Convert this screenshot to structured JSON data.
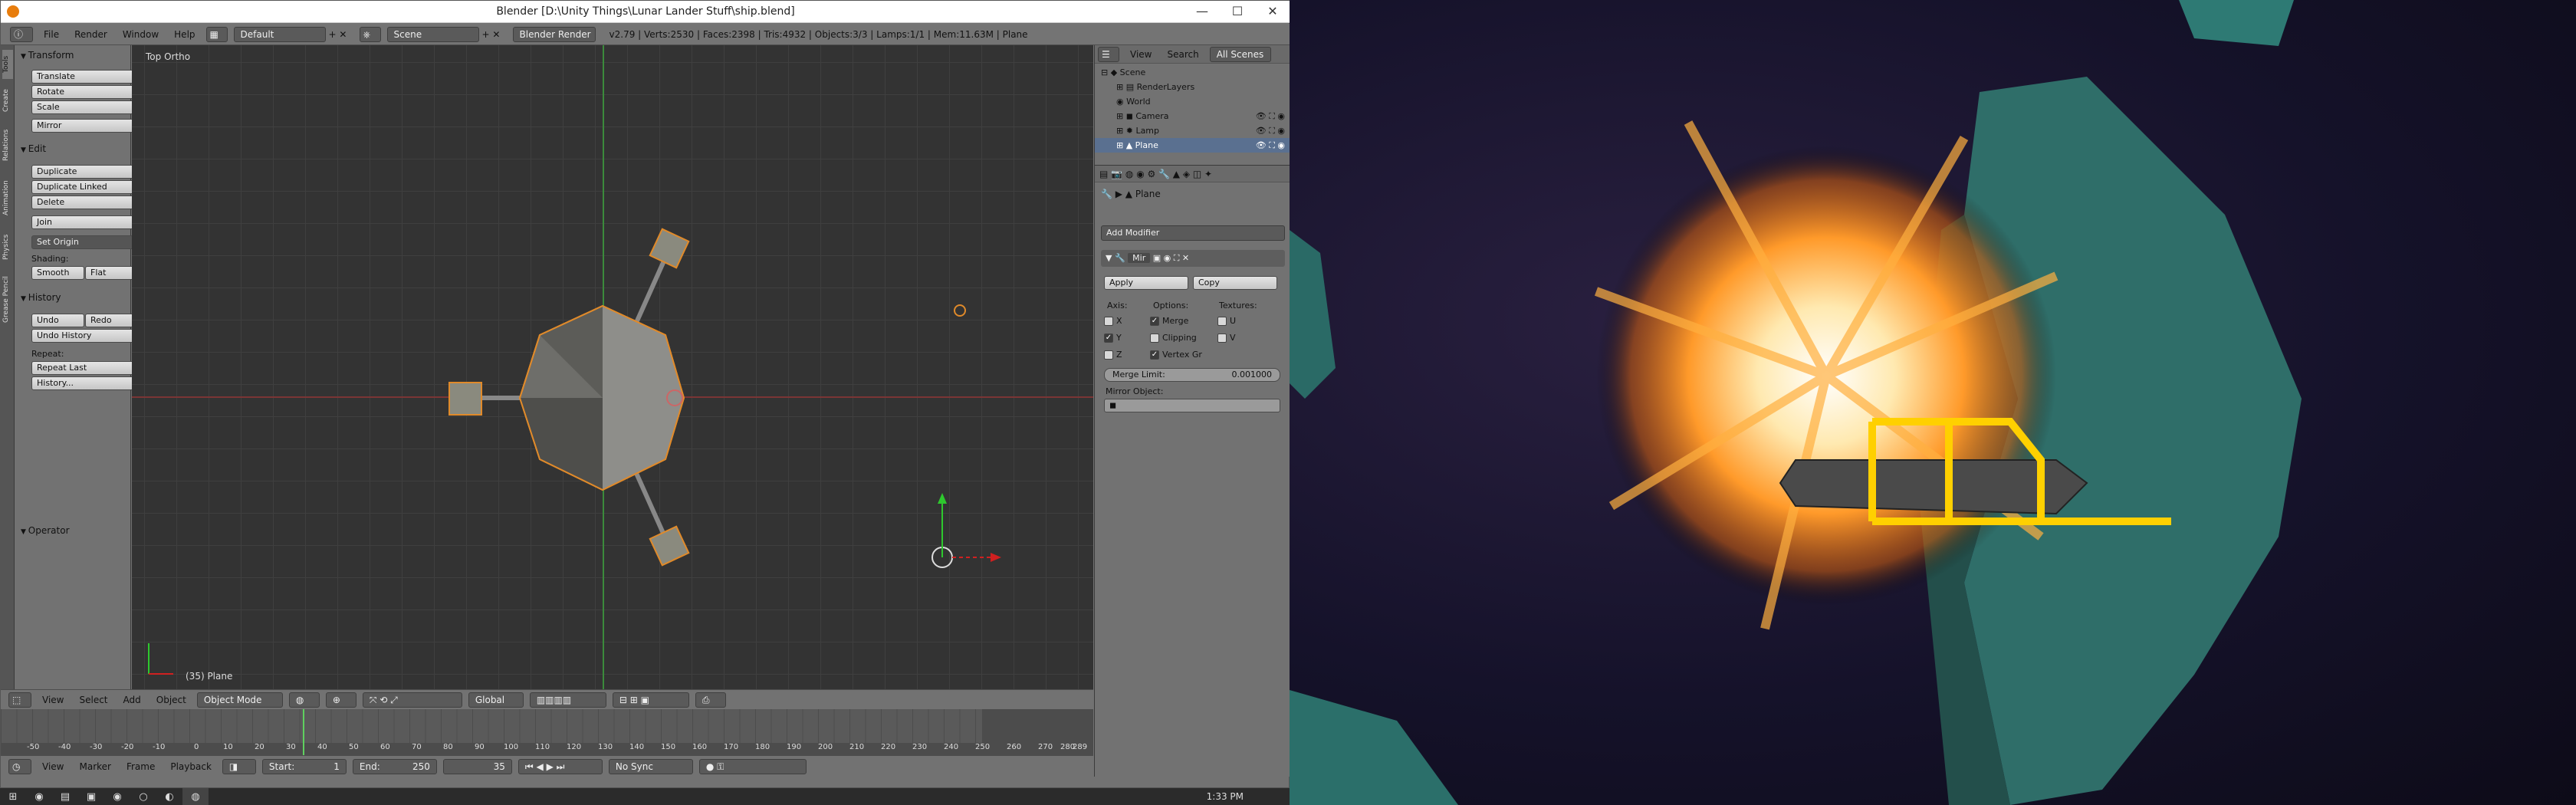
{
  "window": {
    "title": "Blender [D:\\Unity Things\\Lunar Lander Stuff\\ship.blend]",
    "minimize": "—",
    "maximize": "☐",
    "close": "✕"
  },
  "info_header": {
    "menu": [
      "File",
      "Render",
      "Window",
      "Help"
    ],
    "layout": "Default",
    "scene": "Scene",
    "engine": "Blender Render",
    "stats": "v2.79 | Verts:2530 | Faces:2398 | Tris:4932 | Objects:3/3 | Lamps:1/1 | Mem:11.63M | Plane"
  },
  "tool_shelf": {
    "tabs": [
      "Tools",
      "Create",
      "Relations",
      "Animation",
      "Physics",
      "Grease Pencil"
    ],
    "transform": {
      "heading": "Transform",
      "buttons": [
        "Translate",
        "Rotate",
        "Scale",
        "Mirror"
      ]
    },
    "edit": {
      "heading": "Edit",
      "buttons": [
        "Duplicate",
        "Duplicate Linked",
        "Delete",
        "Join"
      ],
      "set_origin": "Set Origin",
      "shading_label": "Shading:",
      "smooth": "Smooth",
      "flat": "Flat"
    },
    "history": {
      "heading": "History",
      "undo": "Undo",
      "redo": "Redo",
      "undo_history": "Undo History",
      "repeat_label": "Repeat:",
      "repeat_last": "Repeat Last",
      "history": "History..."
    },
    "operator_heading": "Operator"
  },
  "viewport": {
    "view_name": "Top Ortho",
    "object_label": "(35) Plane"
  },
  "view3d_header": {
    "menu": [
      "View",
      "Select",
      "Add",
      "Object"
    ],
    "mode": "Object Mode",
    "orientation": "Global"
  },
  "timeline": {
    "ticks": [
      "-50",
      "-40",
      "-30",
      "-20",
      "-10",
      "0",
      "10",
      "20",
      "30",
      "40",
      "50",
      "60",
      "70",
      "80",
      "90",
      "100",
      "110",
      "120",
      "130",
      "140",
      "150",
      "160",
      "170",
      "180",
      "190",
      "200",
      "210",
      "220",
      "230",
      "240",
      "250",
      "260",
      "270",
      "280",
      "289"
    ],
    "menu": [
      "View",
      "Marker",
      "Frame",
      "Playback"
    ],
    "start": "Start:",
    "start_val": "1",
    "end": "End:",
    "end_val": "250",
    "current": "35",
    "sync": "No Sync"
  },
  "outliner": {
    "menu": [
      "View",
      "Search"
    ],
    "scope": "All Scenes",
    "items": [
      "Scene",
      "RenderLayers",
      "World",
      "Camera",
      "Lamp",
      "Plane"
    ]
  },
  "properties": {
    "breadcrumb": "Plane",
    "add_modifier": "Add Modifier",
    "modifier_name": "Mir",
    "apply": "Apply",
    "copy": "Copy",
    "axis_label": "Axis:",
    "options_label": "Options:",
    "textures_label": "Textures:",
    "axes": [
      "X",
      "Y",
      "Z"
    ],
    "options": [
      "Merge",
      "Clipping",
      "Vertex Gr"
    ],
    "textures": [
      "U",
      "V"
    ],
    "merge_limit_label": "Merge Limit:",
    "merge_limit_value": "0.001000",
    "mirror_object_label": "Mirror Object:"
  },
  "taskbar": {
    "time": "1:33 PM"
  }
}
